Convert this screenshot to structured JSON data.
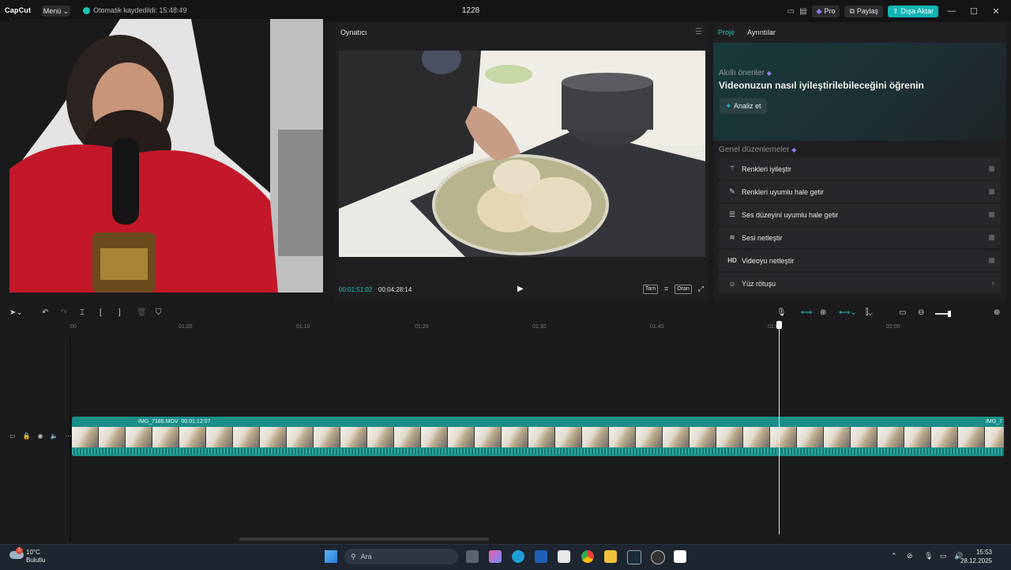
{
  "app": {
    "logo": "CapCut",
    "menu_label": "Menü",
    "save_status": "Otomatik kaydedildi: 15:48:49",
    "project_title": "1228",
    "pro_label": "Pro",
    "share_label": "Paylaş",
    "export_label": "Dışa Aktar"
  },
  "player": {
    "title": "Oynatıcı",
    "current_time": "00:01:51:02",
    "total_time": "00:04:28:14",
    "tools": [
      "Tam",
      "Oran"
    ]
  },
  "right_panel": {
    "tabs": [
      "Proje",
      "Ayrıntılar"
    ],
    "smart_subtitle": "Akıllı öneriler",
    "smart_heading": "Videonuzun nasıl iyileştirilebileceğini öğrenin",
    "analyze_label": "Analiz et",
    "general_heading": "Genel düzenlemeler",
    "options": [
      {
        "label": "Renkleri iyileştir",
        "icon": "wand-icon"
      },
      {
        "label": "Renkleri uyumlu hale getir",
        "icon": "brush-icon"
      },
      {
        "label": "Ses düzeyini uyumlu hale getir",
        "icon": "sliders-icon"
      },
      {
        "label": "Sesi netleştir",
        "icon": "waveform-icon"
      },
      {
        "label": "Videoyu netleştir",
        "icon": "hd-icon"
      },
      {
        "label": "Yüz rötuşu",
        "icon": "face-icon"
      }
    ]
  },
  "timeline": {
    "ruler_labels": [
      "00",
      "01:00",
      "01:10",
      "01:20",
      "01:30",
      "01:40",
      "01:50",
      "02:00"
    ],
    "clip_name": "IMG_7188.MOV",
    "clip_duration": "00:01:12:07",
    "clip_name_next": "IMG_7"
  },
  "taskbar": {
    "notification_count": "1",
    "weather_temp": "10°C",
    "weather_desc": "Bulutlu",
    "search_placeholder": "Ara",
    "time": "15:53",
    "date": "28.12.2025"
  },
  "colors": {
    "accent": "#1fc2b5",
    "export": "#10b4b4",
    "clip": "#1a8f88"
  }
}
